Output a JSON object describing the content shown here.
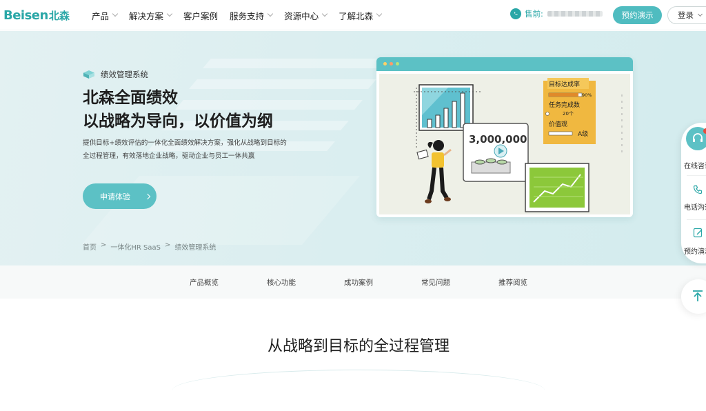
{
  "header": {
    "logo_en": "Beisen",
    "logo_cn": "北森",
    "nav": [
      {
        "label": "产品",
        "has_dropdown": true
      },
      {
        "label": "解决方案",
        "has_dropdown": true
      },
      {
        "label": "客户案例",
        "has_dropdown": false
      },
      {
        "label": "服务支持",
        "has_dropdown": true
      },
      {
        "label": "资源中心",
        "has_dropdown": true
      },
      {
        "label": "了解北森",
        "has_dropdown": true
      }
    ],
    "sales_label": "售前:",
    "demo_button": "预约演示",
    "login_button": "登录"
  },
  "hero": {
    "badge": "绩效管理系统",
    "title_line1": "北森全面绩效",
    "title_line2": "以战略为导向，以价值为纲",
    "desc_line1": "提供目标+绩效评估的一体化全面绩效解决方案，强化从战略到目标的",
    "desc_line2": "全过程管理，有效落地企业战略，驱动企业与员工一体共赢",
    "apply_button": "申请体验",
    "breadcrumb": [
      "首页",
      ">",
      "一体化HR SaaS",
      ">",
      "绩效管理系统"
    ]
  },
  "illustration": {
    "big_number": "3,000,000",
    "card_title1": "目标达成率",
    "card_percent": "90%",
    "card_title2": "任务完成数",
    "card_count": "20个",
    "card_title3": "价值观",
    "card_grade": "A级"
  },
  "tabs": [
    "产品概览",
    "核心功能",
    "成功案例",
    "常见问题",
    "推荐阅览"
  ],
  "section_title": "从战略到目标的全过程管理",
  "side": {
    "online": "在线咨询",
    "phone": "电话沟通",
    "demo": "预约演示"
  },
  "colors": {
    "brand": "#2aa7a7",
    "button": "#5cc1c5",
    "hero_bg": "#dbeef0",
    "card_yellow": "#f0b840",
    "chart_green": "#8cc83a"
  }
}
